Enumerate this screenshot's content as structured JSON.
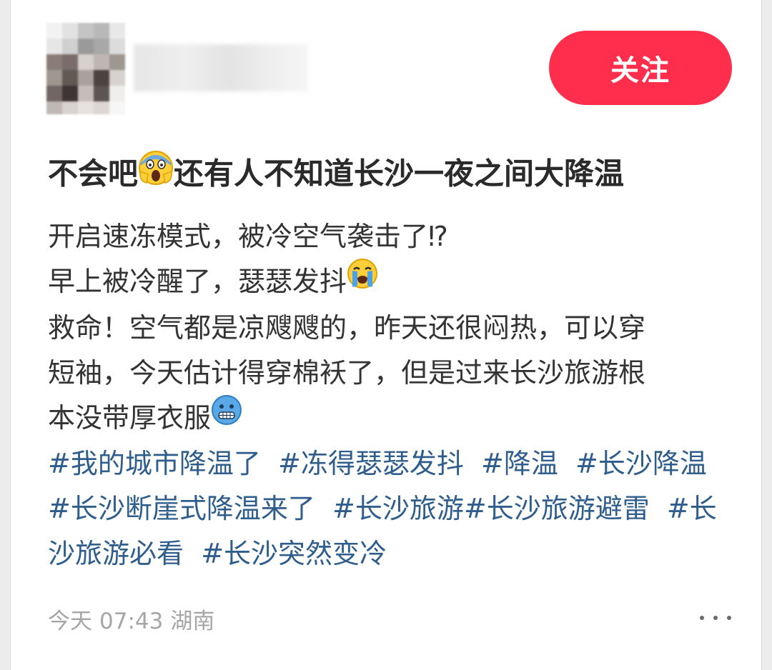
{
  "post": {
    "follow_label": "关注",
    "title": {
      "before_emoji": "不会吧",
      "emoji_icon": "screaming-face-icon",
      "after_emoji": "还有人不知道长沙一夜之间大降温"
    },
    "body": {
      "line1": "开启速冻模式，被冷空气袭击了⁉",
      "line2_text": "早上被冷醒了，瑟瑟发抖",
      "line2_emoji_icon": "loudly-crying-face-icon",
      "line3": "救命！空气都是凉飕飕的，昨天还很闷热，可以穿",
      "line4": "短袖，今天估计得穿棉袄了，但是过来长沙旅游根",
      "line5_text": "本没带厚衣服",
      "line5_emoji_icon": "cold-face-icon"
    },
    "tags": [
      "#我的城市降温了",
      "#冻得瑟瑟发抖",
      "#降温",
      "#长沙降温",
      "#长沙断崖式降温来了",
      "#长沙旅游",
      "#长沙旅游避雷",
      "#长沙旅游必看",
      "#长沙突然变冷"
    ],
    "meta": {
      "date": "今天",
      "time": "07:43",
      "location": "湖南"
    },
    "more_icon": "more-dots-icon"
  },
  "colors": {
    "follow_button": "#ff2e4d",
    "tag_link": "#2f5d8c",
    "meta_text": "#a6a6a6",
    "title_text": "#2a2a2a",
    "body_text": "#333333"
  }
}
